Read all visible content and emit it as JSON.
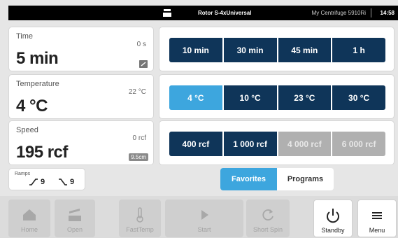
{
  "status_bar": {
    "rotor_label": "Rotor S-4xUniversal",
    "device_name": "My Centrifuge 5910Ri",
    "time": "14:58"
  },
  "time": {
    "label": "Time",
    "value": "5 min",
    "actual": "0 s"
  },
  "temperature": {
    "label": "Temperature",
    "value": "4 °C",
    "actual": "22 °C"
  },
  "speed": {
    "label": "Speed",
    "value": "195 rcf",
    "actual": "0 rcf",
    "radius_badge": "9.5cm"
  },
  "time_presets": [
    "10 min",
    "30 min",
    "45 min",
    "1 h"
  ],
  "temperature_presets": [
    "4 °C",
    "10 °C",
    "23 °C",
    "30 °C"
  ],
  "temperature_selected_index": 0,
  "speed_presets": [
    "400 rcf",
    "1 000 rcf",
    "4 000 rcf",
    "6 000 rcf"
  ],
  "speed_disabled_indices": [
    2,
    3
  ],
  "ramps": {
    "label": "Ramps",
    "up": "9",
    "down": "9"
  },
  "list_tabs": {
    "favorites": "Favorites",
    "programs": "Programs",
    "active": "Favorites"
  },
  "bottom_bar": {
    "home": "Home",
    "open": "Open",
    "fasttemp": "FastTemp",
    "start": "Start",
    "short_spin": "Short Spin",
    "standby": "Standby",
    "menu": "Menu"
  },
  "colors": {
    "navy": "#0f3559",
    "accent_blue": "#3da6de",
    "disabled_gray": "#b0b0b0",
    "background": "#e6e6e6"
  }
}
